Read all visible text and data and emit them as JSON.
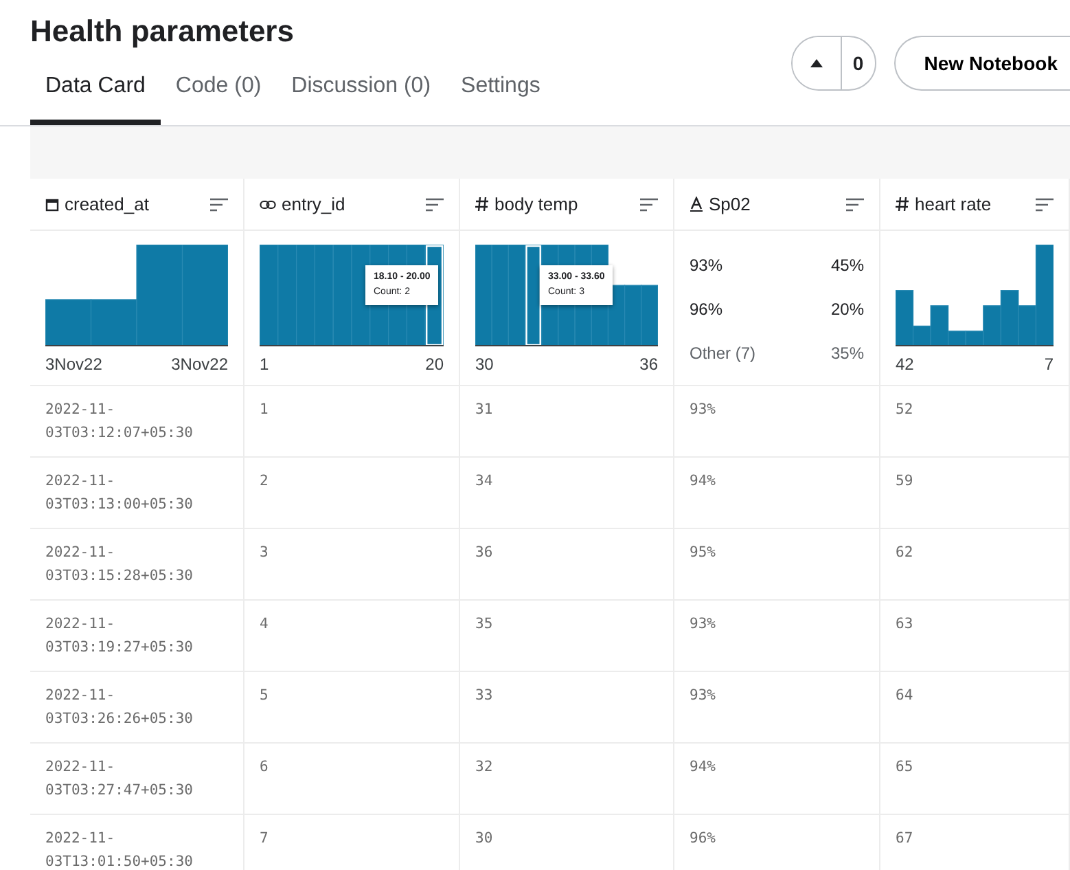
{
  "title": "Health parameters",
  "tabs": [
    {
      "label": "Data Card",
      "selected": true
    },
    {
      "label": "Code (0)",
      "selected": false
    },
    {
      "label": "Discussion (0)",
      "selected": false
    },
    {
      "label": "Settings",
      "selected": false
    }
  ],
  "vote": {
    "count": "0"
  },
  "new_notebook_button": "New Notebook",
  "columns": [
    {
      "name": "created_at",
      "kind": "date",
      "summary": {
        "kind": "histogram",
        "axis_min": "3Nov22",
        "axis_max": "3Nov22"
      }
    },
    {
      "name": "entry_id",
      "kind": "id",
      "summary": {
        "kind": "histogram",
        "axis_min": "1",
        "axis_max": "20",
        "tooltip": {
          "range": "18.10 - 20.00",
          "count": "Count: 2"
        }
      }
    },
    {
      "name": "body temp",
      "kind": "numeric",
      "summary": {
        "kind": "histogram",
        "axis_min": "30",
        "axis_max": "36",
        "tooltip": {
          "range": "33.00 - 33.60",
          "count": "Count: 3"
        }
      }
    },
    {
      "name": "Sp02",
      "kind": "string",
      "summary": {
        "kind": "categories",
        "items": [
          {
            "label": "93%",
            "share": "45%"
          },
          {
            "label": "96%",
            "share": "20%"
          },
          {
            "label": "Other (7)",
            "share": "35%"
          }
        ]
      }
    },
    {
      "name": "heart rate",
      "kind": "numeric",
      "summary": {
        "kind": "histogram",
        "axis_min": "42",
        "axis_max": "7"
      }
    }
  ],
  "rows": [
    [
      "2022-11-03T03:12:07+05:30",
      "1",
      "31",
      "93%",
      "52"
    ],
    [
      "2022-11-03T03:13:00+05:30",
      "2",
      "34",
      "94%",
      "59"
    ],
    [
      "2022-11-03T03:15:28+05:30",
      "3",
      "36",
      "95%",
      "62"
    ],
    [
      "2022-11-03T03:19:27+05:30",
      "4",
      "35",
      "93%",
      "63"
    ],
    [
      "2022-11-03T03:26:26+05:30",
      "5",
      "33",
      "93%",
      "64"
    ],
    [
      "2022-11-03T03:27:47+05:30",
      "6",
      "32",
      "94%",
      "65"
    ],
    [
      "2022-11-03T13:01:50+05:30",
      "7",
      "30",
      "96%",
      "67"
    ]
  ]
}
